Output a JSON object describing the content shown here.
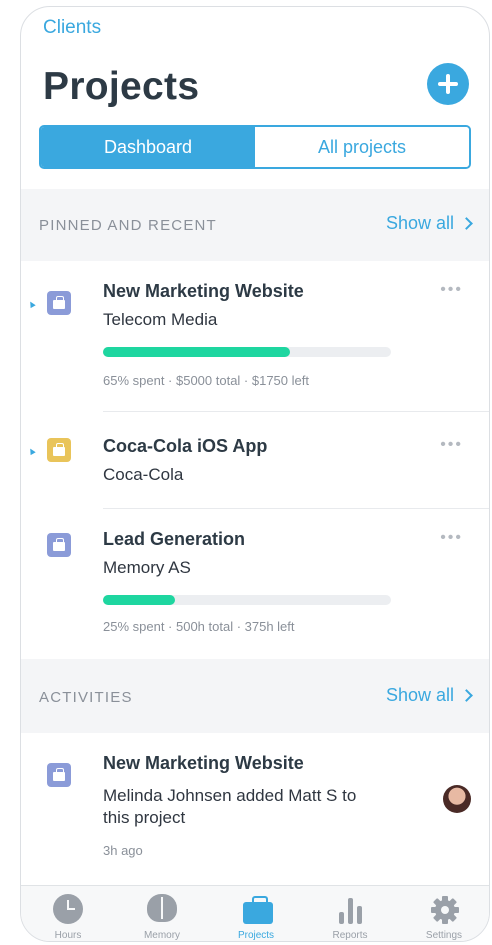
{
  "header": {
    "back_label": "Clients",
    "title": "Projects",
    "add_icon": "plus-icon"
  },
  "segments": [
    {
      "label": "Dashboard",
      "active": true
    },
    {
      "label": "All projects",
      "active": false
    }
  ],
  "pinned_section": {
    "title": "PINNED AND RECENT",
    "show_all": "Show all",
    "items": [
      {
        "title": "New Marketing Website",
        "client": "Telecom Media",
        "pinned": true,
        "icon_color": "#8b9bd8",
        "progress": 0.65,
        "summary": "65% spent · $5000 total · $1750 left"
      },
      {
        "title": "Coca-Cola iOS App",
        "client": "Coca-Cola",
        "pinned": true,
        "icon_color": "#e9c45a"
      },
      {
        "title": "Lead Generation",
        "client": "Memory AS",
        "pinned": false,
        "icon_color": "#8b9bd8",
        "progress": 0.25,
        "summary": "25% spent · 500h total · 375h left"
      }
    ]
  },
  "activities_section": {
    "title": "ACTIVITIES",
    "show_all": "Show all",
    "items": [
      {
        "title": "New Marketing Website",
        "text": "Melinda Johnsen added Matt S to this project",
        "time": "3h ago",
        "icon_color": "#8b9bd8"
      }
    ]
  },
  "tab_bar": {
    "active": "Projects",
    "tabs": [
      {
        "label": "Hours",
        "icon": "clock-icon"
      },
      {
        "label": "Memory",
        "icon": "brain-icon"
      },
      {
        "label": "Projects",
        "icon": "briefcase-icon"
      },
      {
        "label": "Reports",
        "icon": "bar-chart-icon"
      },
      {
        "label": "Settings",
        "icon": "gear-icon"
      }
    ]
  },
  "colors": {
    "accent": "#3aa8df",
    "progress": "#1ed6a0",
    "project_icon_blue": "#8b9bd8",
    "project_icon_yellow": "#e9c45a"
  }
}
